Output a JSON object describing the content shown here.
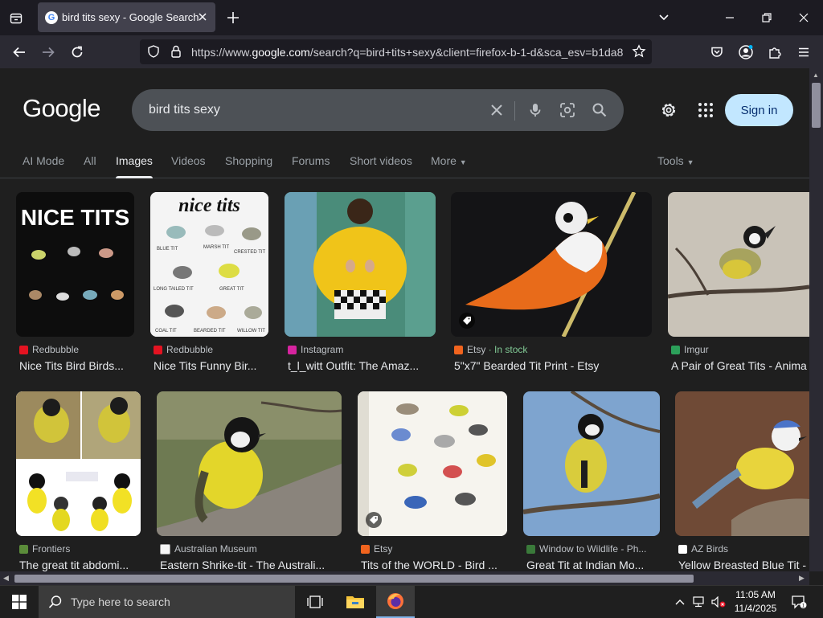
{
  "browser": {
    "tab_title": "bird tits sexy - Google Search",
    "url_pre": "https://www.",
    "url_host": "google.com",
    "url_rest": "/search?q=bird+tits+sexy&client=firefox-b-1-d&sca_esv=b1da8"
  },
  "google": {
    "logo": "Google",
    "query": "bird tits sexy",
    "sign_in": "Sign in",
    "tabs": [
      "AI Mode",
      "All",
      "Images",
      "Videos",
      "Shopping",
      "Forums",
      "Short videos",
      "More"
    ],
    "tools": "Tools"
  },
  "results": [
    {
      "source": "Redbubble",
      "caption": "Nice Tits Bird Birds..."
    },
    {
      "source": "Redbubble",
      "caption": "Nice Tits Funny Bir..."
    },
    {
      "source": "Instagram",
      "caption": "t_l_witt Outfit: The Amaz..."
    },
    {
      "source": "Etsy",
      "stock": "· In stock",
      "caption": "5\"x7\" Bearded Tit Print - Etsy"
    },
    {
      "source": "Imgur",
      "caption": "A Pair of Great Tits - Anima"
    },
    {
      "source": "Frontiers",
      "caption": "The great tit abdomi..."
    },
    {
      "source": "Australian Museum",
      "caption": "Eastern Shrike-tit - The Australi..."
    },
    {
      "source": "Etsy",
      "caption": "Tits of the WORLD - Bird ..."
    },
    {
      "source": "Window to Wildlife - Ph...",
      "caption": "Great Tit at Indian Mo..."
    },
    {
      "source": "AZ Birds",
      "caption": "Yellow Breasted Blue Tit -"
    }
  ],
  "image_text": {
    "r1": "NICE TITS",
    "r2_title": "nice tits",
    "r2_labels": [
      "BLUE TIT",
      "MARSH TIT",
      "CRESTED TIT",
      "LONG TAILED TIT",
      "GREAT TIT",
      "COAL TIT",
      "BEARDED TIT",
      "WILLOW TIT"
    ]
  },
  "taskbar": {
    "search_placeholder": "Type here to search",
    "time": "11:05 AM",
    "date": "11/4/2025"
  }
}
